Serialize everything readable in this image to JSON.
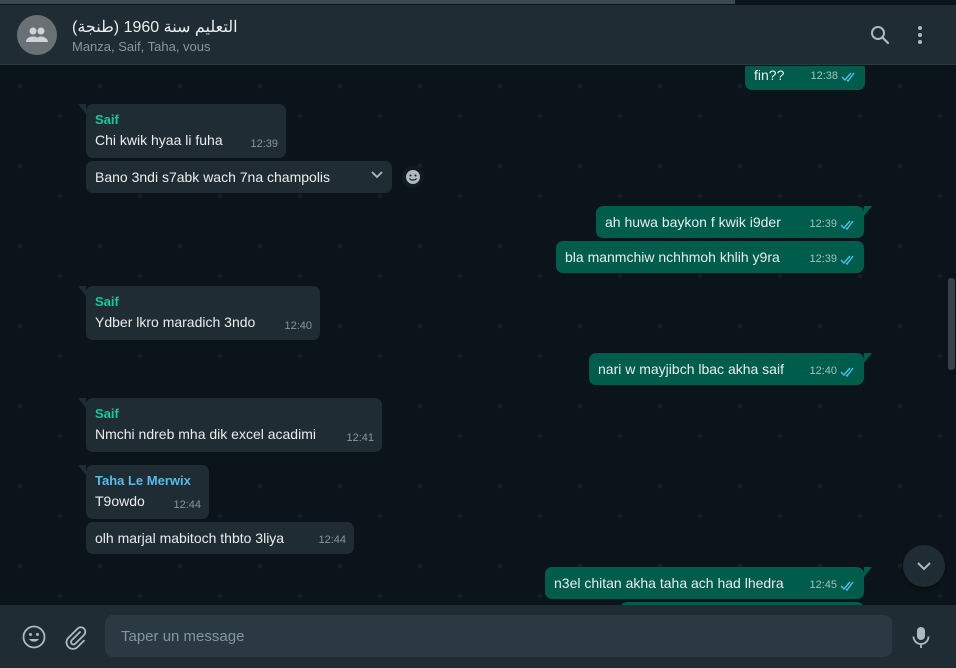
{
  "header": {
    "title": "التعليم سنة 1960 (طنجة)",
    "members": "Manza, Saif, Taha, vous"
  },
  "colors": {
    "header_bg": "#202c33",
    "chat_bg": "#0b141a",
    "incoming_bubble": "#202c33",
    "outgoing_bubble": "#005c4b",
    "sender_green": "#06cf9c",
    "sender_blue": "#53bdeb",
    "read_tick": "#53bdeb"
  },
  "icons": {
    "avatar": "group-avatar-icon",
    "search": "search-icon",
    "menu": "kebab-menu-icon",
    "emoji": "emoji-icon",
    "attach": "paperclip-icon",
    "mic": "microphone-icon",
    "scroll": "chevron-down-icon",
    "react": "emoji-react-icon"
  },
  "messages": [
    {
      "dir": "out",
      "text": "fin??",
      "time": "12:38",
      "ticks": "read"
    },
    {
      "dir": "in",
      "sender": "Saif",
      "text": "Chi kwik hyaa li fuha",
      "time": "12:39"
    },
    {
      "dir": "in",
      "text": "Bano 3ndi s7abk wach 7na champolis",
      "time": ""
    },
    {
      "dir": "out",
      "text": "ah huwa baykon f kwik i9der",
      "time": "12:39",
      "ticks": "read"
    },
    {
      "dir": "out",
      "text": "bla manmchiw nchhmoh khlih y9ra",
      "time": "12:39",
      "ticks": "read"
    },
    {
      "dir": "in",
      "sender": "Saif",
      "text": "Ydber lkro maradich 3ndo",
      "time": "12:40"
    },
    {
      "dir": "out",
      "text": "nari w mayjibch lbac akha saif",
      "time": "12:40",
      "ticks": "read"
    },
    {
      "dir": "in",
      "sender": "Saif",
      "text": "Nmchi ndreb mha dik excel acadimi",
      "time": "12:41"
    },
    {
      "dir": "in",
      "sender": "Taha Le Merwix",
      "text": "T9owdo",
      "time": "12:44"
    },
    {
      "dir": "in",
      "text": "olh marjal mabitoch thbto 3liya",
      "time": "12:44"
    },
    {
      "dir": "out",
      "text": "n3el chitan akha taha ach had lhedra",
      "time": "12:45",
      "ticks": "read"
    }
  ],
  "composer": {
    "placeholder": "Taper un message"
  }
}
